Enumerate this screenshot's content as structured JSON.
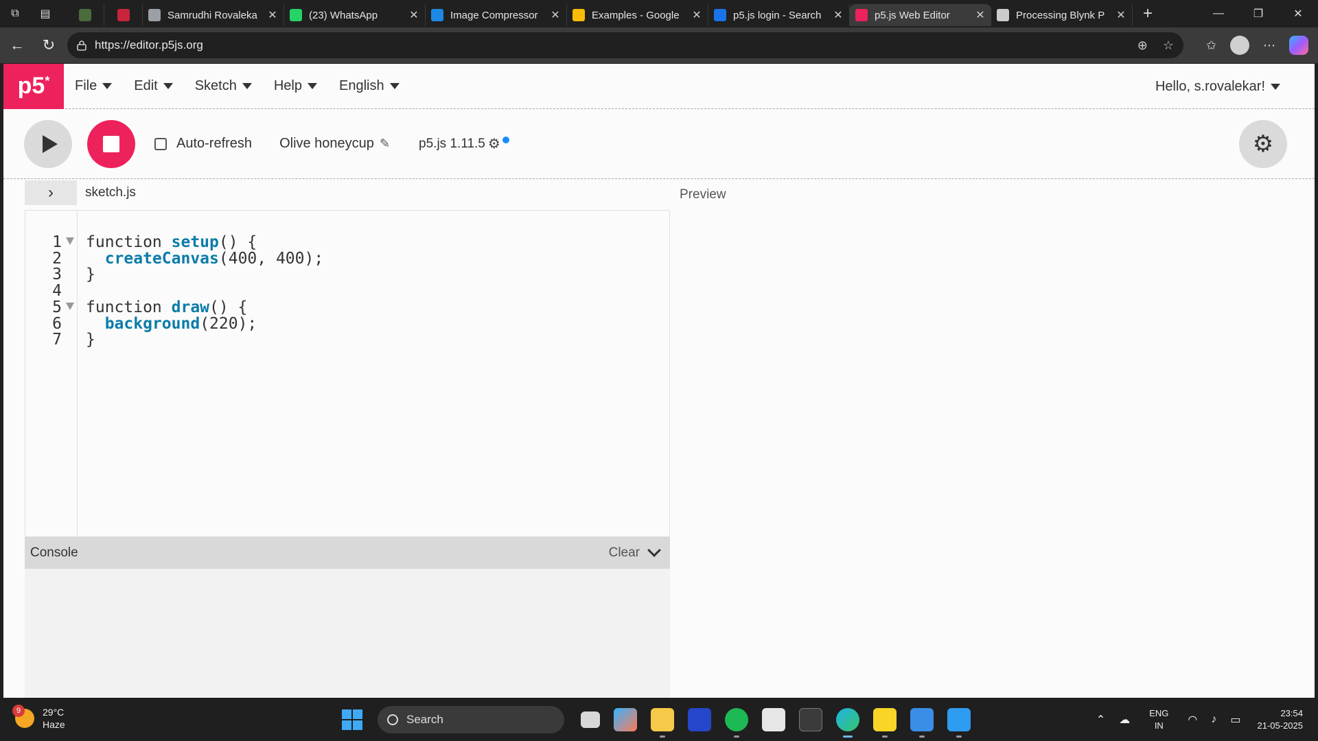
{
  "browser": {
    "tabs": [
      {
        "title": "",
        "color": "#4a6b3a"
      },
      {
        "title": "",
        "color": "#c8243c"
      },
      {
        "title": "Samrudhi Rovaleka",
        "color": "#9aa0a6"
      },
      {
        "title": "(23) WhatsApp",
        "color": "#25d366"
      },
      {
        "title": "Image Compressor",
        "color": "#1e88e5"
      },
      {
        "title": "Examples - Google",
        "color": "#fbbc04"
      },
      {
        "title": "p5.js login - Search",
        "color": "#1a73e8"
      },
      {
        "title": "p5.js Web Editor",
        "color": "#ed225d"
      },
      {
        "title": "Processing Blynk P",
        "color": "#cccccc"
      }
    ],
    "url": "https://editor.p5js.org"
  },
  "nav": {
    "logo": "p5",
    "logo_star": "*",
    "menus": [
      "File",
      "Edit",
      "Sketch",
      "Help",
      "English"
    ],
    "user": "Hello, s.rovalekar!"
  },
  "toolbar": {
    "autorefresh_label": "Auto-refresh",
    "sketch_name": "Olive honeycup",
    "version": "p5.js 1.11.5"
  },
  "editor": {
    "filename": "sketch.js",
    "preview_label": "Preview",
    "lines": [
      {
        "n": "1",
        "fold": true,
        "parts": [
          {
            "t": "function ",
            "c": "kw"
          },
          {
            "t": "setup",
            "c": "fn"
          },
          {
            "t": "() {",
            "c": "kw"
          }
        ]
      },
      {
        "n": "2",
        "fold": false,
        "parts": [
          {
            "t": "  ",
            "c": "kw"
          },
          {
            "t": "createCanvas",
            "c": "fn"
          },
          {
            "t": "(400, 400);",
            "c": "kw"
          }
        ]
      },
      {
        "n": "3",
        "fold": false,
        "parts": [
          {
            "t": "}",
            "c": "kw"
          }
        ]
      },
      {
        "n": "4",
        "fold": false,
        "parts": []
      },
      {
        "n": "5",
        "fold": true,
        "parts": [
          {
            "t": "function ",
            "c": "kw"
          },
          {
            "t": "draw",
            "c": "fn"
          },
          {
            "t": "() {",
            "c": "kw"
          }
        ]
      },
      {
        "n": "6",
        "fold": false,
        "parts": [
          {
            "t": "  ",
            "c": "kw"
          },
          {
            "t": "background",
            "c": "fn"
          },
          {
            "t": "(220);",
            "c": "kw"
          }
        ]
      },
      {
        "n": "7",
        "fold": false,
        "parts": [
          {
            "t": "}",
            "c": "kw"
          }
        ]
      }
    ]
  },
  "console": {
    "label": "Console",
    "clear_label": "Clear"
  },
  "taskbar": {
    "weather_badge": "9",
    "temperature": "29°C",
    "condition": "Haze",
    "search_label": "Search",
    "lang_top": "ENG",
    "lang_bottom": "IN",
    "time": "23:54",
    "date": "21-05-2025"
  },
  "colors": {
    "accent": "#ed225d",
    "code_function": "#0b7ca9"
  }
}
